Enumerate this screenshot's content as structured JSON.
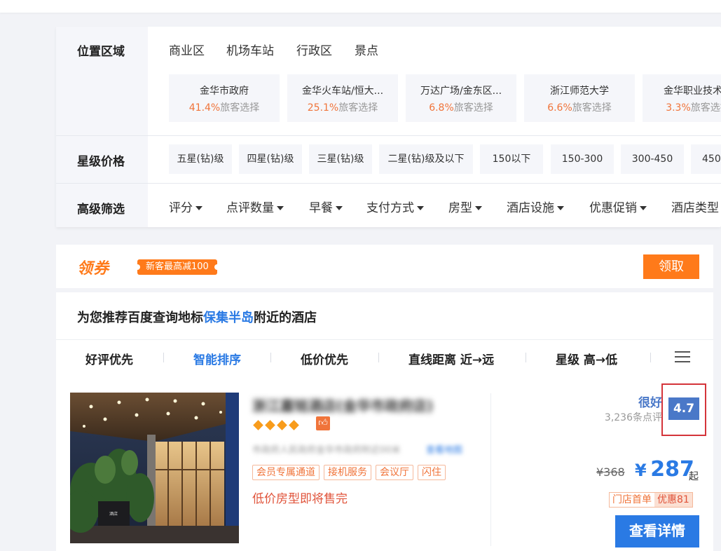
{
  "filters": {
    "location": {
      "label": "位置区域",
      "tabs": [
        {
          "label": "商业区",
          "active": true
        },
        {
          "label": "机场车站",
          "active": false
        },
        {
          "label": "行政区",
          "active": false
        },
        {
          "label": "景点",
          "active": false
        }
      ],
      "places": [
        {
          "name": "金华市政府",
          "pct": "41.4%",
          "suffix": "旅客选择"
        },
        {
          "name": "金华火车站/恒大...",
          "pct": "25.1%",
          "suffix": "旅客选择"
        },
        {
          "name": "万达广场/金东区...",
          "pct": "6.8%",
          "suffix": "旅客选择"
        },
        {
          "name": "浙江师范大学",
          "pct": "6.6%",
          "suffix": "旅客选择"
        },
        {
          "name": "金华职业技术学",
          "pct": "3.3%",
          "suffix": "旅客选择"
        }
      ]
    },
    "star": {
      "label": "星级价格",
      "options": [
        "五星(钻)级",
        "四星(钻)级",
        "三星(钻)级",
        "二星(钻)级及以下",
        "150以下",
        "150-300",
        "300-450",
        "450"
      ]
    },
    "advanced": {
      "label": "高级筛选",
      "options": [
        "评分",
        "点评数量",
        "早餐",
        "支付方式",
        "房型",
        "酒店设施",
        "优惠促销",
        "酒店类型"
      ]
    }
  },
  "coupon": {
    "logo": "领券",
    "tag": "新客最高减100",
    "button": "领取"
  },
  "recommend": {
    "prefix": "为您推荐百度查询地标",
    "landmark": "保集半岛",
    "suffix": "附近的酒店"
  },
  "sort": {
    "options": [
      {
        "label": "好评优先",
        "active": false
      },
      {
        "label": "智能排序",
        "active": true
      },
      {
        "label": "低价优先",
        "active": false
      },
      {
        "label": "直线距离 近→远",
        "active": false
      },
      {
        "label": "星级 高→低",
        "active": false
      }
    ]
  },
  "hotel": {
    "name": "浙江嘉铭酒店(金华市政府店)",
    "address": "市政府人民政府金华市政府附近00米",
    "map_link": "查看地图",
    "tags": [
      "会员专属通道",
      "接机服务",
      "会议厅",
      "闪住"
    ],
    "low_price_note": "低价房型即将售完",
    "rating_word": "很好",
    "review_count": "3,236条点评",
    "score": "4.7",
    "old_price": "¥368",
    "price_currency": "¥",
    "price": "287",
    "price_suffix": "起",
    "promo_a": "门店首单",
    "promo_b": "优惠81",
    "detail_button": "查看详情"
  },
  "colors": {
    "accent": "#2a7ae4",
    "orange": "#ff7a1a",
    "score_bg": "#4a78c8",
    "highlight": "#d4343a"
  }
}
